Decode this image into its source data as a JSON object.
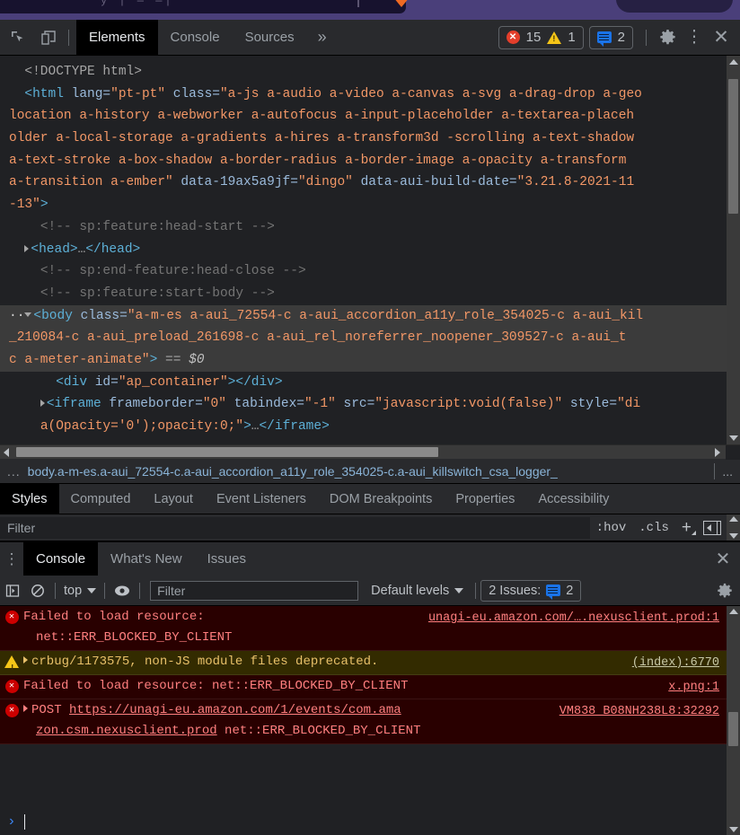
{
  "page_strip": {
    "glyph_text": "у | — —|",
    "caret_icon": "orange-caret-icon",
    "pill": "rounded-pill"
  },
  "devtools_toolbar": {
    "inspect_icon": "inspect-element-icon",
    "device_icon": "device-toolbar-icon",
    "tabs": [
      {
        "label": "Elements",
        "active": true
      },
      {
        "label": "Console",
        "active": false
      },
      {
        "label": "Sources",
        "active": false
      }
    ],
    "more_tabs_label": "»",
    "error_count": "15",
    "warning_count": "1",
    "message_count": "2",
    "settings_icon": "gear-icon",
    "more_icon": "vertical-dots-icon",
    "close_icon": "close-icon"
  },
  "dom_tree": {
    "lines": [
      {
        "indent": 1,
        "parts": [
          {
            "t": "<!DOCTYPE html>",
            "c": "punct"
          }
        ]
      },
      {
        "indent": 1,
        "parts": [
          {
            "t": "<html",
            "c": "tagname"
          },
          {
            "t": " lang=",
            "c": "attrname"
          },
          {
            "t": "\"pt-pt\"",
            "c": "attrval"
          },
          {
            "t": " class=",
            "c": "attrname"
          },
          {
            "t": "\"a-js a-audio a-video a-canvas a-svg a-drag-drop a-geo",
            "c": "attrval"
          }
        ]
      },
      {
        "indent": 0,
        "parts": [
          {
            "t": "location a-history a-webworker a-autofocus a-input-placeholder a-textarea-placeh",
            "c": "attrval"
          }
        ]
      },
      {
        "indent": 0,
        "parts": [
          {
            "t": "older a-local-storage a-gradients a-hires a-transform3d -scrolling a-text-shadow",
            "c": "attrval"
          }
        ]
      },
      {
        "indent": 0,
        "parts": [
          {
            "t": "a-text-stroke a-box-shadow a-border-radius a-border-image a-opacity a-transform",
            "c": "attrval"
          }
        ]
      },
      {
        "indent": 0,
        "parts": [
          {
            "t": "a-transition a-ember\"",
            "c": "attrval"
          },
          {
            "t": " data-19ax5a9jf=",
            "c": "attrname"
          },
          {
            "t": "\"dingo\"",
            "c": "attrval"
          },
          {
            "t": " data-aui-build-date=",
            "c": "attrname"
          },
          {
            "t": "\"3.21.8-2021-11",
            "c": "attrval"
          }
        ]
      },
      {
        "indent": 0,
        "parts": [
          {
            "t": "-13\"",
            "c": "attrval"
          },
          {
            "t": ">",
            "c": "tagname"
          }
        ]
      },
      {
        "indent": 2,
        "parts": [
          {
            "t": "<!-- sp:feature:head-start -->",
            "c": "comment"
          }
        ]
      },
      {
        "indent": 1,
        "arrow": "right",
        "parts": [
          {
            "t": "<head>",
            "c": "tagname"
          },
          {
            "t": "…",
            "c": "punct"
          },
          {
            "t": "</head>",
            "c": "tagname"
          }
        ]
      },
      {
        "indent": 2,
        "parts": [
          {
            "t": "<!-- sp:end-feature:head-close -->",
            "c": "comment"
          }
        ]
      },
      {
        "indent": 2,
        "parts": [
          {
            "t": "<!-- sp:feature:start-body -->",
            "c": "comment"
          }
        ]
      },
      {
        "indent": 0,
        "selected": true,
        "marker": "··",
        "arrow": "down",
        "parts": [
          {
            "t": "<body",
            "c": "tagname"
          },
          {
            "t": " class=",
            "c": "attrname"
          },
          {
            "t": "\"a-m-es a-aui_72554-c a-aui_accordion_a11y_role_354025-c a-aui_kil",
            "c": "attrval"
          }
        ]
      },
      {
        "indent": 0,
        "selected": true,
        "parts": [
          {
            "t": "_210084-c a-aui_preload_261698-c a-aui_rel_noreferrer_noopener_309527-c a-aui_t",
            "c": "attrval"
          }
        ]
      },
      {
        "indent": 0,
        "selected": true,
        "parts": [
          {
            "t": "c a-meter-animate\"",
            "c": "attrval"
          },
          {
            "t": ">",
            "c": "tagname"
          },
          {
            "t": " == ",
            "c": "punct"
          },
          {
            "t": "$0",
            "c": "dollar"
          }
        ]
      },
      {
        "indent": 3,
        "parts": [
          {
            "t": "<div",
            "c": "tagname"
          },
          {
            "t": " id=",
            "c": "attrname"
          },
          {
            "t": "\"ap_container\"",
            "c": "attrval"
          },
          {
            "t": "></div>",
            "c": "tagname"
          }
        ]
      },
      {
        "indent": 2,
        "arrow": "right",
        "parts": [
          {
            "t": "<iframe",
            "c": "tagname"
          },
          {
            "t": " frameborder=",
            "c": "attrname"
          },
          {
            "t": "\"0\"",
            "c": "attrval"
          },
          {
            "t": " tabindex=",
            "c": "attrname"
          },
          {
            "t": "\"-1\"",
            "c": "attrval"
          },
          {
            "t": " src=",
            "c": "attrname"
          },
          {
            "t": "\"javascript:void(false)\"",
            "c": "attrval"
          },
          {
            "t": " style=",
            "c": "attrname"
          },
          {
            "t": "\"di",
            "c": "attrval"
          }
        ]
      },
      {
        "indent": 2,
        "parts": [
          {
            "t": "a(Opacity='0');opacity:0;\"",
            "c": "attrval"
          },
          {
            "t": ">",
            "c": "tagname"
          },
          {
            "t": "…",
            "c": "punct"
          },
          {
            "t": "</iframe>",
            "c": "tagname"
          }
        ]
      }
    ]
  },
  "breadcrumb": {
    "left_overflow": "...",
    "selected": "body.a-m-es.a-aui_72554-c.a-aui_accordion_a11y_role_354025-c.a-aui_killswitch_csa_logger_",
    "right_overflow": "..."
  },
  "styles_pane": {
    "tabs": [
      {
        "label": "Styles",
        "active": true
      },
      {
        "label": "Computed",
        "active": false
      },
      {
        "label": "Layout",
        "active": false
      },
      {
        "label": "Event Listeners",
        "active": false
      },
      {
        "label": "DOM Breakpoints",
        "active": false
      },
      {
        "label": "Properties",
        "active": false
      },
      {
        "label": "Accessibility",
        "active": false
      }
    ],
    "filter_placeholder": "Filter",
    "filter_value": "",
    "hov_label": ":hov",
    "cls_label": ".cls",
    "new_rule_icon": "plus-icon",
    "panel_toggle_icon": "toggle-sidebar-icon"
  },
  "drawer": {
    "more_icon": "vertical-dots-icon",
    "tabs": [
      {
        "label": "Console",
        "active": true
      },
      {
        "label": "What's New",
        "active": false
      },
      {
        "label": "Issues",
        "active": false
      }
    ],
    "close_icon": "close-icon"
  },
  "console_toolbar": {
    "sidebar_icon": "console-sidebar-icon",
    "clear_icon": "clear-console-icon",
    "context_label": "top",
    "eye_icon": "live-expression-icon",
    "filter_placeholder": "Filter",
    "filter_value": "",
    "levels_label": "Default levels",
    "issues_label": "2 Issues:",
    "issues_count": "2",
    "settings_icon": "gear-icon"
  },
  "console_messages": [
    {
      "level": "error",
      "icon": "error-icon",
      "expandable": false,
      "text_lines": [
        [
          {
            "t": "Failed to load resource: ",
            "u": false
          }
        ],
        [
          {
            "t": "net::ERR_BLOCKED_BY_CLIENT",
            "u": false
          }
        ]
      ],
      "source": "unagi-eu.amazon.com/….nexusclient.prod:1"
    },
    {
      "level": "warn",
      "icon": "warning-icon",
      "expandable": true,
      "text_lines": [
        [
          {
            "t": "crbug/1173575, non-JS module files deprecated.",
            "u": false
          }
        ]
      ],
      "source": "(index):6770"
    },
    {
      "level": "error",
      "icon": "error-icon",
      "expandable": false,
      "text_lines": [
        [
          {
            "t": "Failed to load resource: net::ERR_BLOCKED_BY_CLIENT",
            "u": false
          }
        ]
      ],
      "source": "x.png:1"
    },
    {
      "level": "error",
      "icon": "error-icon",
      "expandable": true,
      "text_lines": [
        [
          {
            "t": "POST ",
            "u": false
          },
          {
            "t": "https://unagi-eu.amazon.com/1/events/com.ama",
            "u": true
          }
        ],
        [
          {
            "t": "zon.csm.nexusclient.prod",
            "u": true
          },
          {
            "t": " net::ERR_BLOCKED_BY_CLIENT",
            "u": false
          }
        ]
      ],
      "source": "VM838_B08NH238L8:32292"
    }
  ],
  "console_prompt": {
    "chevron": "›",
    "value": ""
  },
  "colors": {
    "accent_blue": "#1a73e8",
    "error_red": "#cc0000",
    "warning_yellow": "#f5c518",
    "tag_blue": "#5db0d7",
    "attr_orange": "#f29766",
    "panel_bg": "#292a2d",
    "content_bg": "#202124"
  }
}
